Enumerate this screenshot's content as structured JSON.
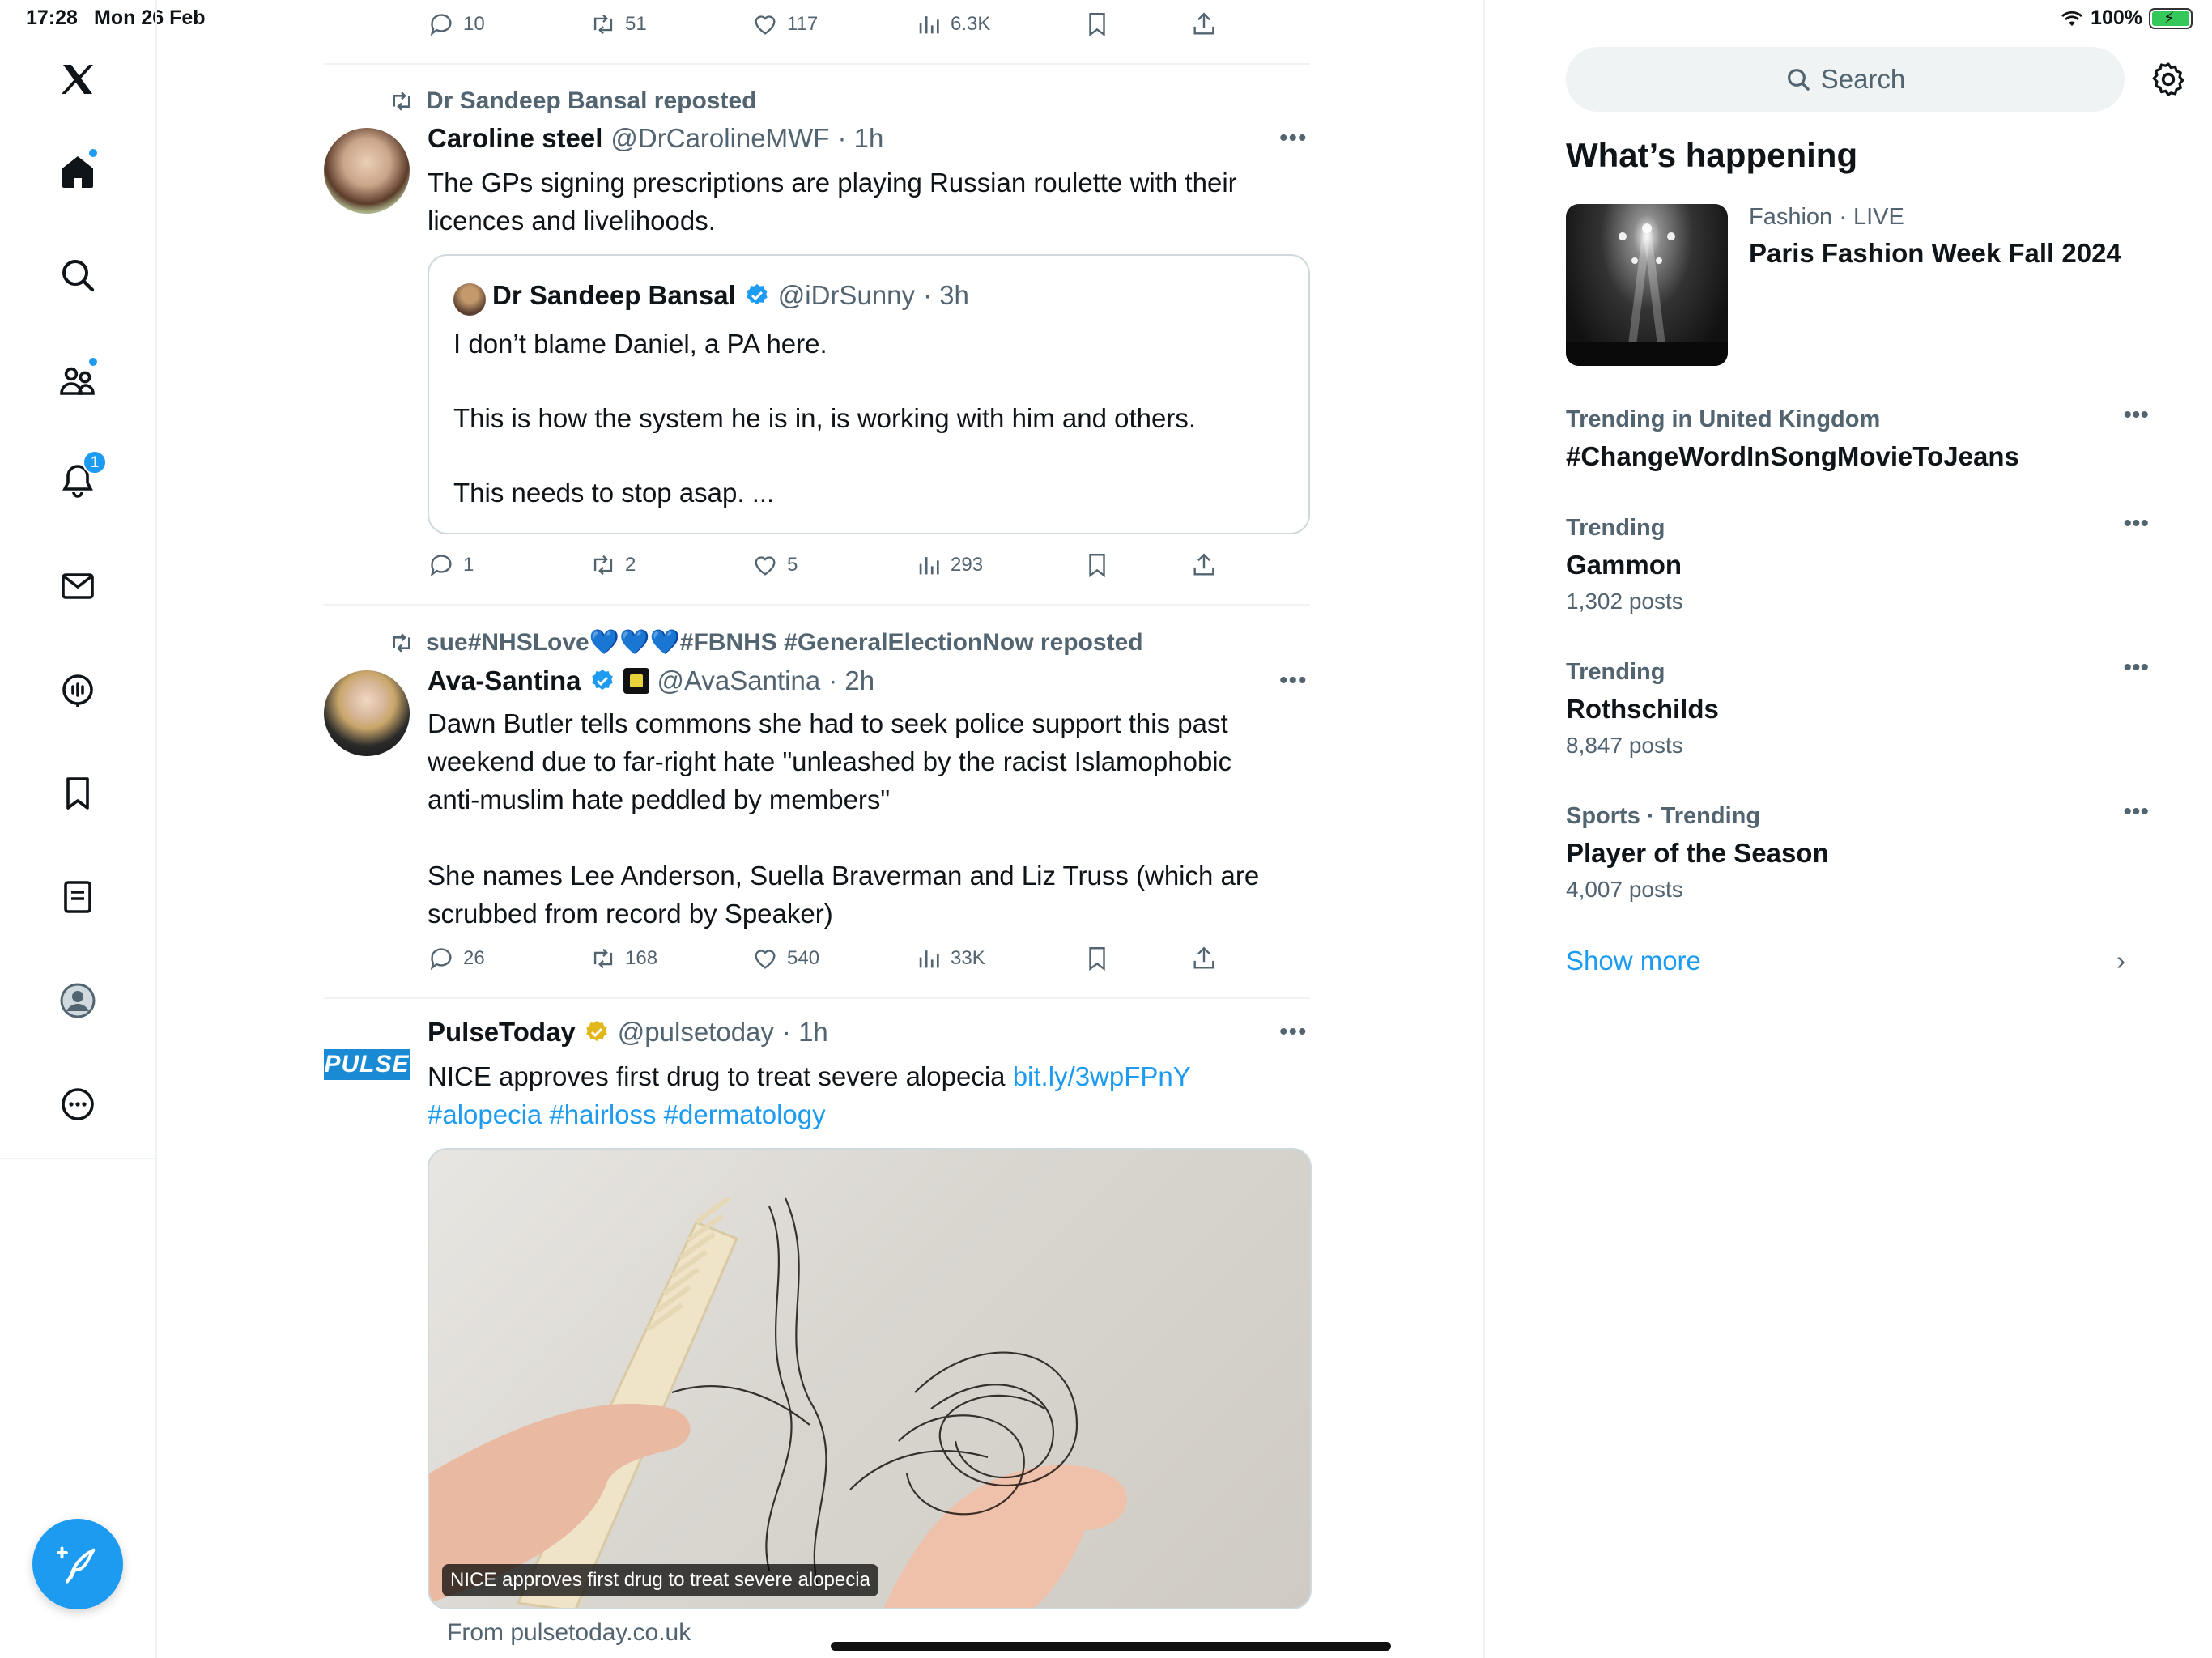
{
  "status": {
    "time": "17:28",
    "date": "Mon 26 Feb",
    "battery": "100%"
  },
  "nav": {
    "notifications_badge": "1"
  },
  "feed": {
    "top_actions": {
      "replies": "10",
      "reposts": "51",
      "likes": "117",
      "views": "6.3K"
    },
    "tweets": [
      {
        "repost_label": "Dr Sandeep Bansal reposted",
        "name": "Caroline steel",
        "handle": "@DrCarolineMWF",
        "time": "· 1h",
        "text": "The GPs signing prescriptions are playing Russian roulette with their\nlicences and livelihoods.",
        "quote": {
          "name": "Dr Sandeep Bansal",
          "handle": "@iDrSunny",
          "time": "· 3h",
          "text": "I don’t blame Daniel, a PA here.\n\nThis is how the system he is in, is working with him and others.\n\nThis needs to stop asap. ..."
        },
        "actions": {
          "replies": "1",
          "reposts": "2",
          "likes": "5",
          "views": "293"
        }
      },
      {
        "repost_label": "sue#NHSLove💙💙💙#FBNHS #GeneralElectionNow reposted",
        "name": "Ava-Santina",
        "handle": "@AvaSantina",
        "time": "· 2h",
        "text": "Dawn Butler tells commons she had to seek police support this past\nweekend due to far-right hate \"unleashed by the racist Islamophobic\nanti-muslim hate peddled by members\"\n\nShe names Lee Anderson, Suella Braverman and Liz Truss (which are\nscrubbed from record by Speaker)",
        "actions": {
          "replies": "26",
          "reposts": "168",
          "likes": "540",
          "views": "33K"
        }
      },
      {
        "avatar_text": "PULSE",
        "name": "PulseToday",
        "handle": "@pulsetoday",
        "time": "· 1h",
        "text_main": "NICE approves first drug to treat severe alopecia ",
        "link": "bit.ly/3wpFPnY",
        "hashtags": "#alopecia #hairloss #dermatology",
        "media_caption": "NICE approves first drug to treat severe alopecia",
        "media_source": "From pulsetoday.co.uk"
      }
    ]
  },
  "sidebar": {
    "search_placeholder": "Search",
    "title": "What’s happening",
    "event": {
      "category": "Fashion",
      "status": " · LIVE",
      "title": "Paris Fashion Week Fall 2024"
    },
    "trends": [
      {
        "meta": "Trending in United Kingdom",
        "name": "#ChangeWordInSongMovieToJeans",
        "count": ""
      },
      {
        "meta": "Trending",
        "name": "Gammon",
        "count": "1,302 posts"
      },
      {
        "meta": "Trending",
        "name": "Rothschilds",
        "count": "8,847 posts"
      },
      {
        "meta": "Sports · Trending",
        "name": "Player of the Season",
        "count": "4,007 posts"
      }
    ],
    "show_more": "Show more"
  },
  "colors": {
    "accent": "#1d9bf0",
    "secondary_text": "#536471",
    "verified_blue": "#1d9bf0",
    "verified_gold": "#e2b719"
  }
}
